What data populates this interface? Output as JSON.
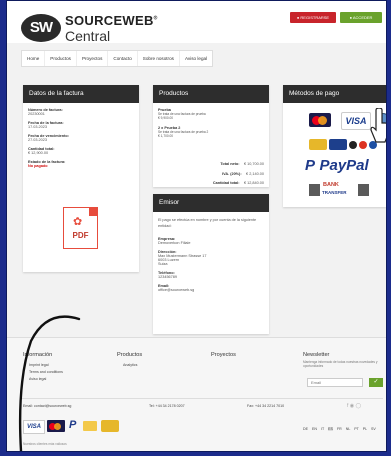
{
  "header": {
    "logo_initials": "SW",
    "logo_name": "SOURCEWEB",
    "logo_sup": "®",
    "logo_sub": "Central",
    "register_label": "REGISTRARSE",
    "login_label": "ACCEDER"
  },
  "nav": [
    "Home",
    "Productos",
    "Proyectos",
    "Contacto",
    "Sobre nosotros",
    "Aviso legal"
  ],
  "invoice": {
    "title": "Datos de la factura",
    "number_label": "Número de factura:",
    "number_value": "20230001",
    "date_label": "Fecha de la factura:",
    "date_value": "17.03.2023",
    "due_label": "Fecha de vencimiento:",
    "due_value": "27.03.2023",
    "total_label": "Cantidad total:",
    "total_value": "€ 12,900.00",
    "status_label": "Estado de la factura:",
    "status_value": "No pagado",
    "pdf_label": "PDF"
  },
  "products": {
    "title": "Productos",
    "items": [
      {
        "name": "Prueba",
        "desc": "Se trata de una factura de prueba",
        "price": "€ 9,900.00"
      },
      {
        "name": "2 x Prueba 2",
        "desc": "Se trata de una factura de prueba 2",
        "price": "€ 1,700.00"
      }
    ],
    "net_label": "Total neto:",
    "net_value": "€ 10,700.00",
    "vat_label": "IVA. (20%):",
    "vat_value": "€ 2,140.00",
    "grand_label": "Cantidad total:",
    "grand_value": "€ 12,840.00"
  },
  "issuer": {
    "title": "Emisor",
    "intro": "El pago se efectúa en nombre y por cuenta de la siguiente entidad:",
    "company_label": "Empresa:",
    "company_value": "Demoverkon Filiale",
    "address_label": "Dirección:",
    "address_line1": "Max Mustermann Strasse 17",
    "address_line2": "6003 Luzern",
    "address_line3": "Suiza",
    "phone_label": "Teléfono:",
    "phone_value": "123456789",
    "email_label": "Email:",
    "email_value": "office@sourceweb.sg"
  },
  "payment": {
    "title": "Métodos de pago",
    "visa": "VISA",
    "paypal_p": "P",
    "paypal": "PayPal",
    "bank_line1": "BANK",
    "bank_line2": "TRANSFER"
  },
  "footer": {
    "col1_title": "Información",
    "col1_links": [
      "Imprint legal",
      "Terms and conditions",
      "Aviso legal"
    ],
    "col2_title": "Productos",
    "col2_links": [
      "Analytics"
    ],
    "col3_title": "Proyectos",
    "col4_title": "Newsletter",
    "newsletter_text": "Mantenga informado de todas nuestras novedades y oportunidades",
    "email_placeholder": "Email",
    "email_line": "Email: contact@sourceweb.sg",
    "tel_line": "Tel: +44 34 2178 0207",
    "fax_line": "Fax: +44 34 2214 7010",
    "languages": [
      "DE",
      "EN",
      "IT",
      "ES",
      "FR",
      "NL",
      "PT",
      "PL",
      "SV"
    ],
    "copyright": "Nuestros clientes más valiosos"
  },
  "colors": {
    "brand": "#2d2d2d",
    "register": "#c8242b",
    "login": "#6aa22c",
    "background": "#1c2c8c",
    "paypal": "#1e3a8a"
  }
}
